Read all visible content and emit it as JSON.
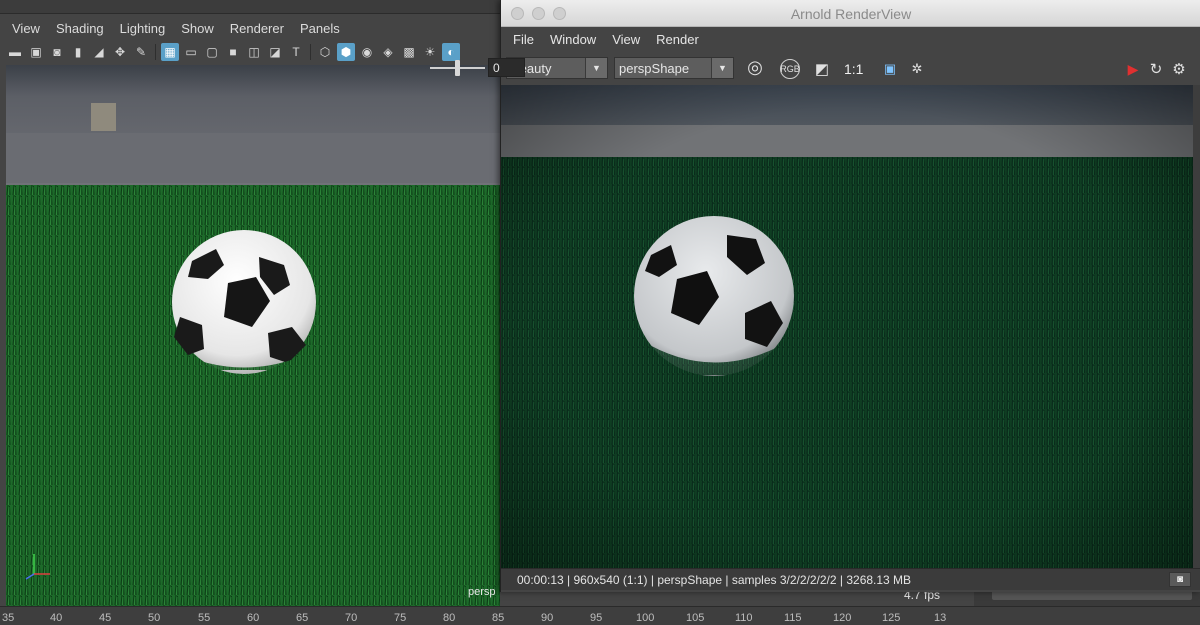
{
  "maya": {
    "menu": [
      "View",
      "Shading",
      "Lighting",
      "Show",
      "Renderer",
      "Panels"
    ],
    "toolbar_icons": [
      "camera-select-icon",
      "camera-attributes-icon",
      "bookmark-icon",
      "image-plane-icon",
      "pivot-icon",
      "grease-pencil-icon",
      "grid-icon",
      "film-gate-icon",
      "resolution-gate-icon",
      "gate-mask-icon",
      "field-chart-icon",
      "safe-action-icon",
      "safe-title-icon",
      "wireframe-icon",
      "smooth-shade-icon",
      "default-material-icon",
      "xray-icon",
      "xray-joints-icon",
      "lights-icon",
      "shadows-icon"
    ],
    "viewport": {
      "camera_label": "persp",
      "fps_label": "4.7 fps"
    },
    "timeline": [
      "35",
      "40",
      "45",
      "50",
      "55",
      "60",
      "65",
      "70",
      "75",
      "80",
      "85",
      "90",
      "95",
      "100",
      "105",
      "110",
      "115",
      "120",
      "125",
      "13"
    ]
  },
  "arnold": {
    "title": "Arnold RenderView",
    "menu": [
      "File",
      "Window",
      "View",
      "Render"
    ],
    "aov_select": "Beauty",
    "camera_select": "perspShape",
    "zoom_label": "1:1",
    "exposure_value": "0",
    "status": "00:00:13 | 960x540 (1:1) | perspShape  | samples 3/2/2/2/2/2 | 3268.13 MB",
    "colors": {
      "render_button": "#e03030",
      "grass_dark": "#0f3d22",
      "grass_viewport": "#1f6b2c"
    }
  }
}
